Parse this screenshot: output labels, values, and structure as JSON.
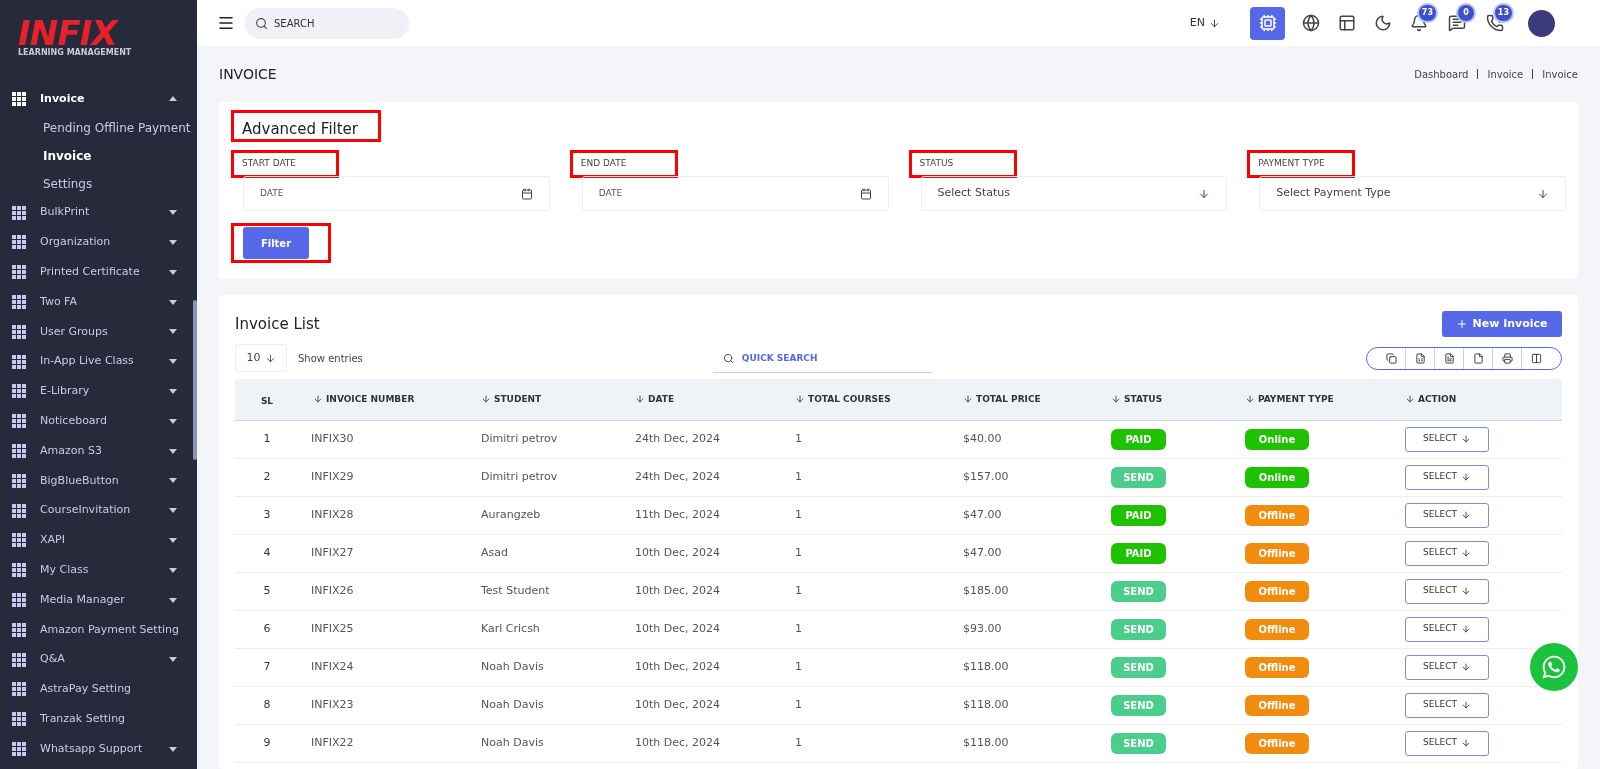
{
  "logo": {
    "name": "INFIX",
    "tagline": "LEARNING MANAGEMENT"
  },
  "sidebar": {
    "items": [
      {
        "label": "Invoice",
        "kind": "group",
        "expanded": true,
        "children": [
          {
            "label": "Pending Offline Payment",
            "selected": false
          },
          {
            "label": "Invoice",
            "selected": true
          },
          {
            "label": "Settings",
            "selected": false
          }
        ]
      },
      {
        "label": "BulkPrint",
        "kind": "group",
        "expanded": false
      },
      {
        "label": "Organization",
        "kind": "group",
        "expanded": false
      },
      {
        "label": "Printed Certificate",
        "kind": "group",
        "expanded": false
      },
      {
        "label": "Two FA",
        "kind": "group",
        "expanded": false
      },
      {
        "label": "User Groups",
        "kind": "group",
        "expanded": false
      },
      {
        "label": "In-App Live Class",
        "kind": "group",
        "expanded": false
      },
      {
        "label": "E-Library",
        "kind": "group",
        "expanded": false
      },
      {
        "label": "Noticeboard",
        "kind": "group",
        "expanded": false
      },
      {
        "label": "Amazon S3",
        "kind": "group",
        "expanded": false
      },
      {
        "label": "BigBlueButton",
        "kind": "group",
        "expanded": false
      },
      {
        "label": "CourseInvitation",
        "kind": "group",
        "expanded": false
      },
      {
        "label": "XAPI",
        "kind": "group",
        "expanded": false
      },
      {
        "label": "My Class",
        "kind": "group",
        "expanded": false
      },
      {
        "label": "Media Manager",
        "kind": "group",
        "expanded": false
      },
      {
        "label": "Amazon Payment Setting",
        "kind": "link"
      },
      {
        "label": "Q&A",
        "kind": "group",
        "expanded": false
      },
      {
        "label": "AstraPay Setting",
        "kind": "link"
      },
      {
        "label": "Tranzak Setting",
        "kind": "link"
      },
      {
        "label": "Whatsapp Support",
        "kind": "group",
        "expanded": false
      }
    ]
  },
  "topbar": {
    "search": {
      "placeholder": "SEARCH"
    },
    "language": "EN",
    "badges": {
      "notifications": "73",
      "messages": "0",
      "chats": "13"
    }
  },
  "page": {
    "title": "INVOICE",
    "breadcrumbs": [
      "Dashboard",
      "Invoice",
      "Invoice"
    ]
  },
  "filter": {
    "title": "Advanced Filter",
    "fields": [
      {
        "label": "START DATE",
        "kind": "date",
        "placeholder": "DATE"
      },
      {
        "label": "END DATE",
        "kind": "date",
        "placeholder": "DATE"
      },
      {
        "label": "STATUS",
        "kind": "select",
        "placeholder": "Select Status"
      },
      {
        "label": "PAYMENT TYPE",
        "kind": "select",
        "placeholder": "Select Payment Type"
      }
    ],
    "button": "Filter"
  },
  "list": {
    "title": "Invoice List",
    "new_button": "New Invoice",
    "page_size": "10",
    "show_entries": "Show entries",
    "quick_search": {
      "placeholder": "QUICK SEARCH"
    },
    "columns": [
      "SL",
      "INVOICE NUMBER",
      "STUDENT",
      "DATE",
      "TOTAL COURSES",
      "TOTAL PRICE",
      "STATUS",
      "PAYMENT TYPE",
      "ACTION"
    ],
    "rows": [
      {
        "sl": "1",
        "number": "INFIX30",
        "student": "Dimitri petrov",
        "date": "24th Dec, 2024",
        "courses": "1",
        "price": "$40.00",
        "status": {
          "text": "PAID",
          "color": "#1ec200"
        },
        "payment": {
          "text": "Online",
          "color": "#1ec200"
        },
        "action": "SELECT"
      },
      {
        "sl": "2",
        "number": "INFIX29",
        "student": "Dimitri petrov",
        "date": "24th Dec, 2024",
        "courses": "1",
        "price": "$157.00",
        "status": {
          "text": "SEND",
          "color": "#4bce8c"
        },
        "payment": {
          "text": "Online",
          "color": "#1ec200"
        },
        "action": "SELECT"
      },
      {
        "sl": "3",
        "number": "INFIX28",
        "student": "Aurangzeb",
        "date": "11th Dec, 2024",
        "courses": "1",
        "price": "$47.00",
        "status": {
          "text": "PAID",
          "color": "#1ec200"
        },
        "payment": {
          "text": "Offline",
          "color": "#f28c0f"
        },
        "action": "SELECT"
      },
      {
        "sl": "4",
        "number": "INFIX27",
        "student": "Asad",
        "date": "10th Dec, 2024",
        "courses": "1",
        "price": "$47.00",
        "status": {
          "text": "PAID",
          "color": "#1ec200"
        },
        "payment": {
          "text": "Offline",
          "color": "#f28c0f"
        },
        "action": "SELECT"
      },
      {
        "sl": "5",
        "number": "INFIX26",
        "student": "Test Student",
        "date": "10th Dec, 2024",
        "courses": "1",
        "price": "$185.00",
        "status": {
          "text": "SEND",
          "color": "#4bce8c"
        },
        "payment": {
          "text": "Offline",
          "color": "#f28c0f"
        },
        "action": "SELECT"
      },
      {
        "sl": "6",
        "number": "INFIX25",
        "student": "Karl Cricsh",
        "date": "10th Dec, 2024",
        "courses": "1",
        "price": "$93.00",
        "status": {
          "text": "SEND",
          "color": "#4bce8c"
        },
        "payment": {
          "text": "Offline",
          "color": "#f28c0f"
        },
        "action": "SELECT"
      },
      {
        "sl": "7",
        "number": "INFIX24",
        "student": "Noah Davis",
        "date": "10th Dec, 2024",
        "courses": "1",
        "price": "$118.00",
        "status": {
          "text": "SEND",
          "color": "#4bce8c"
        },
        "payment": {
          "text": "Offline",
          "color": "#f28c0f"
        },
        "action": "SELECT"
      },
      {
        "sl": "8",
        "number": "INFIX23",
        "student": "Noah Davis",
        "date": "10th Dec, 2024",
        "courses": "1",
        "price": "$118.00",
        "status": {
          "text": "SEND",
          "color": "#4bce8c"
        },
        "payment": {
          "text": "Offline",
          "color": "#f28c0f"
        },
        "action": "SELECT"
      },
      {
        "sl": "9",
        "number": "INFIX22",
        "student": "Noah Davis",
        "date": "10th Dec, 2024",
        "courses": "1",
        "price": "$118.00",
        "status": {
          "text": "SEND",
          "color": "#4bce8c"
        },
        "payment": {
          "text": "Offline",
          "color": "#f28c0f"
        },
        "action": "SELECT"
      }
    ]
  }
}
